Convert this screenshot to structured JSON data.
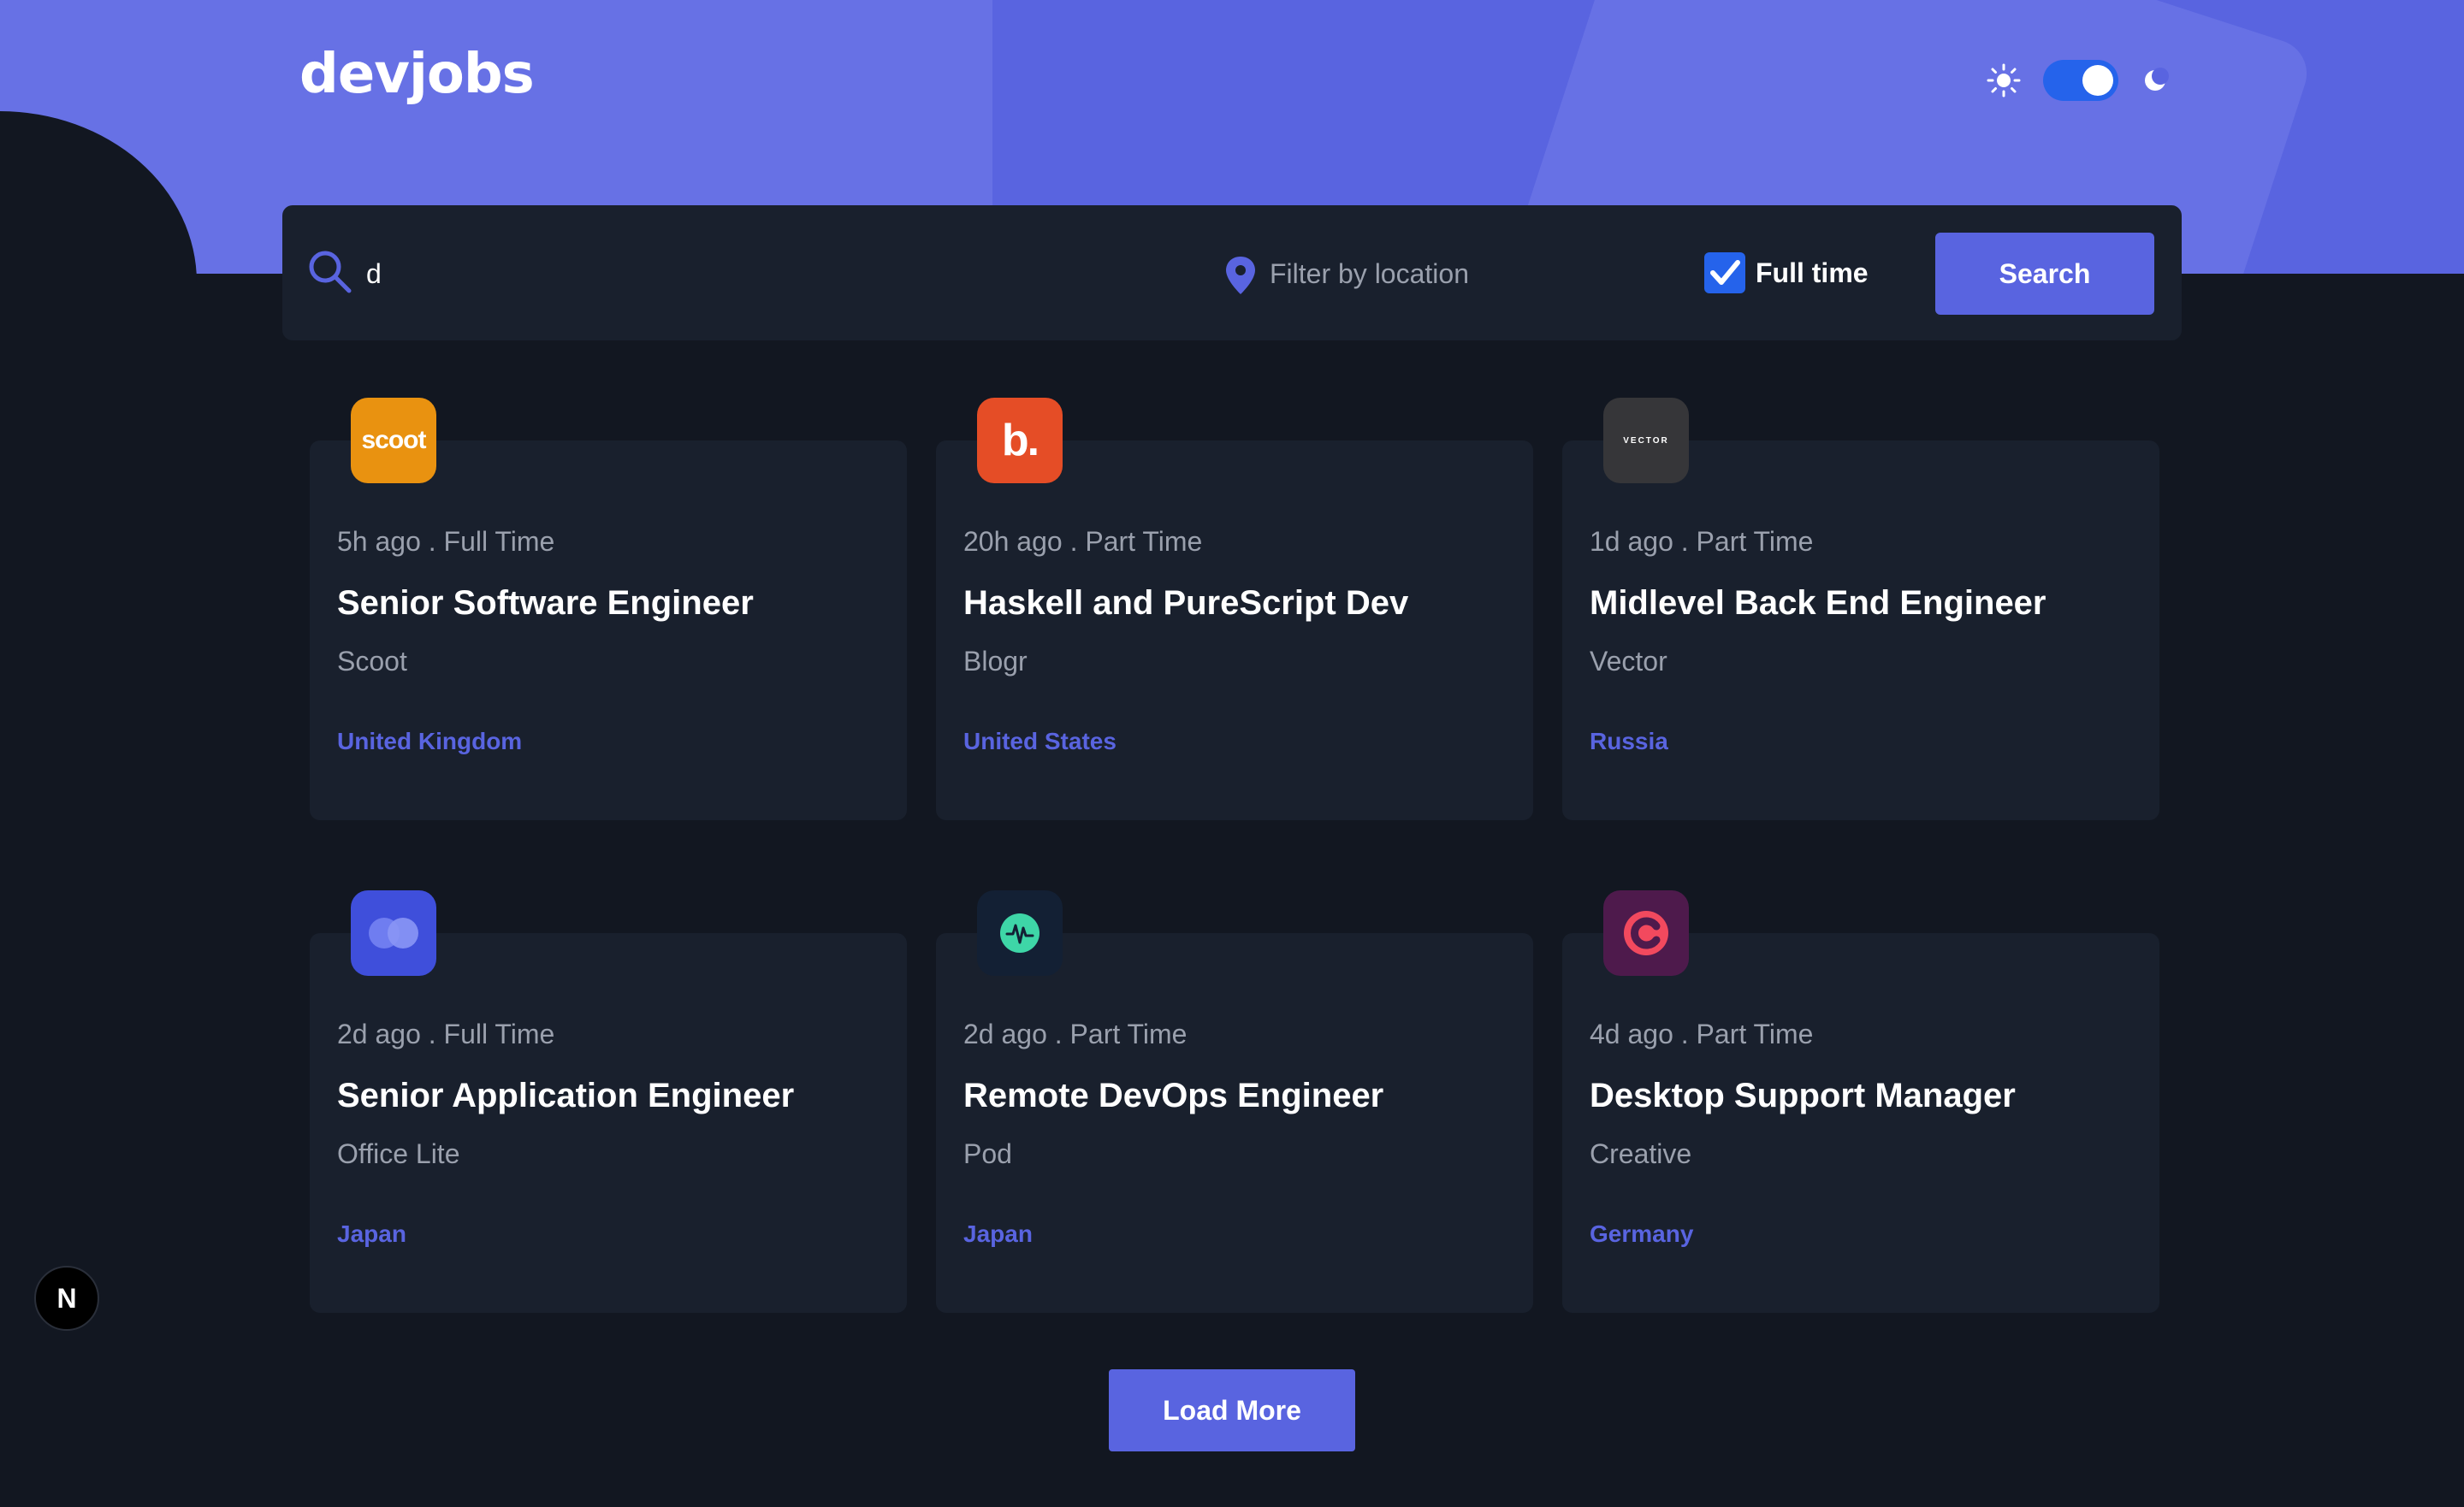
{
  "brand": {
    "logo": "devjobs"
  },
  "theme_toggle": {
    "light_icon": "sun-icon",
    "dark_icon": "moon-icon",
    "state": "on"
  },
  "search": {
    "query_value": "d",
    "location_placeholder": "Filter by location",
    "fulltime_label": "Full time",
    "fulltime_checked": true,
    "button_label": "Search"
  },
  "jobs": [
    {
      "posted": "5h ago",
      "contract": "Full Time",
      "meta": "5h ago . Full Time",
      "title": "Senior Software Engineer",
      "company": "Scoot",
      "location": "United Kingdom",
      "logo_bg": "#e99210",
      "logo_text": "scoot"
    },
    {
      "posted": "20h ago",
      "contract": "Part Time",
      "meta": "20h ago . Part Time",
      "title": "Haskell and PureScript Dev",
      "company": "Blogr",
      "location": "United States",
      "logo_bg": "#e54d26",
      "logo_text": "b."
    },
    {
      "posted": "1d ago",
      "contract": "Part Time",
      "meta": "1d ago . Part Time",
      "title": "Midlevel Back End Engineer",
      "company": "Vector",
      "location": "Russia",
      "logo_bg": "#363639",
      "logo_text": "VECTOR"
    },
    {
      "posted": "2d ago",
      "contract": "Full Time",
      "meta": "2d ago . Full Time",
      "title": "Senior Application Engineer",
      "company": "Office Lite",
      "location": "Japan",
      "logo_bg": "#3f4fdb",
      "logo_text": ""
    },
    {
      "posted": "2d ago",
      "contract": "Part Time",
      "meta": "2d ago . Part Time",
      "title": "Remote DevOps Engineer",
      "company": "Pod",
      "location": "Japan",
      "logo_bg": "#132034",
      "logo_text": ""
    },
    {
      "posted": "4d ago",
      "contract": "Part Time",
      "meta": "4d ago . Part Time",
      "title": "Desktop Support Manager",
      "company": "Creative",
      "location": "Germany",
      "logo_bg": "#4e1a4c",
      "logo_text": ""
    }
  ],
  "load_more": {
    "label": "Load More"
  },
  "dev_badge": {
    "label": "N"
  },
  "colors": {
    "accent": "#5964e0",
    "background": "#121721",
    "card": "#19202d",
    "toggle": "#2563eb"
  }
}
